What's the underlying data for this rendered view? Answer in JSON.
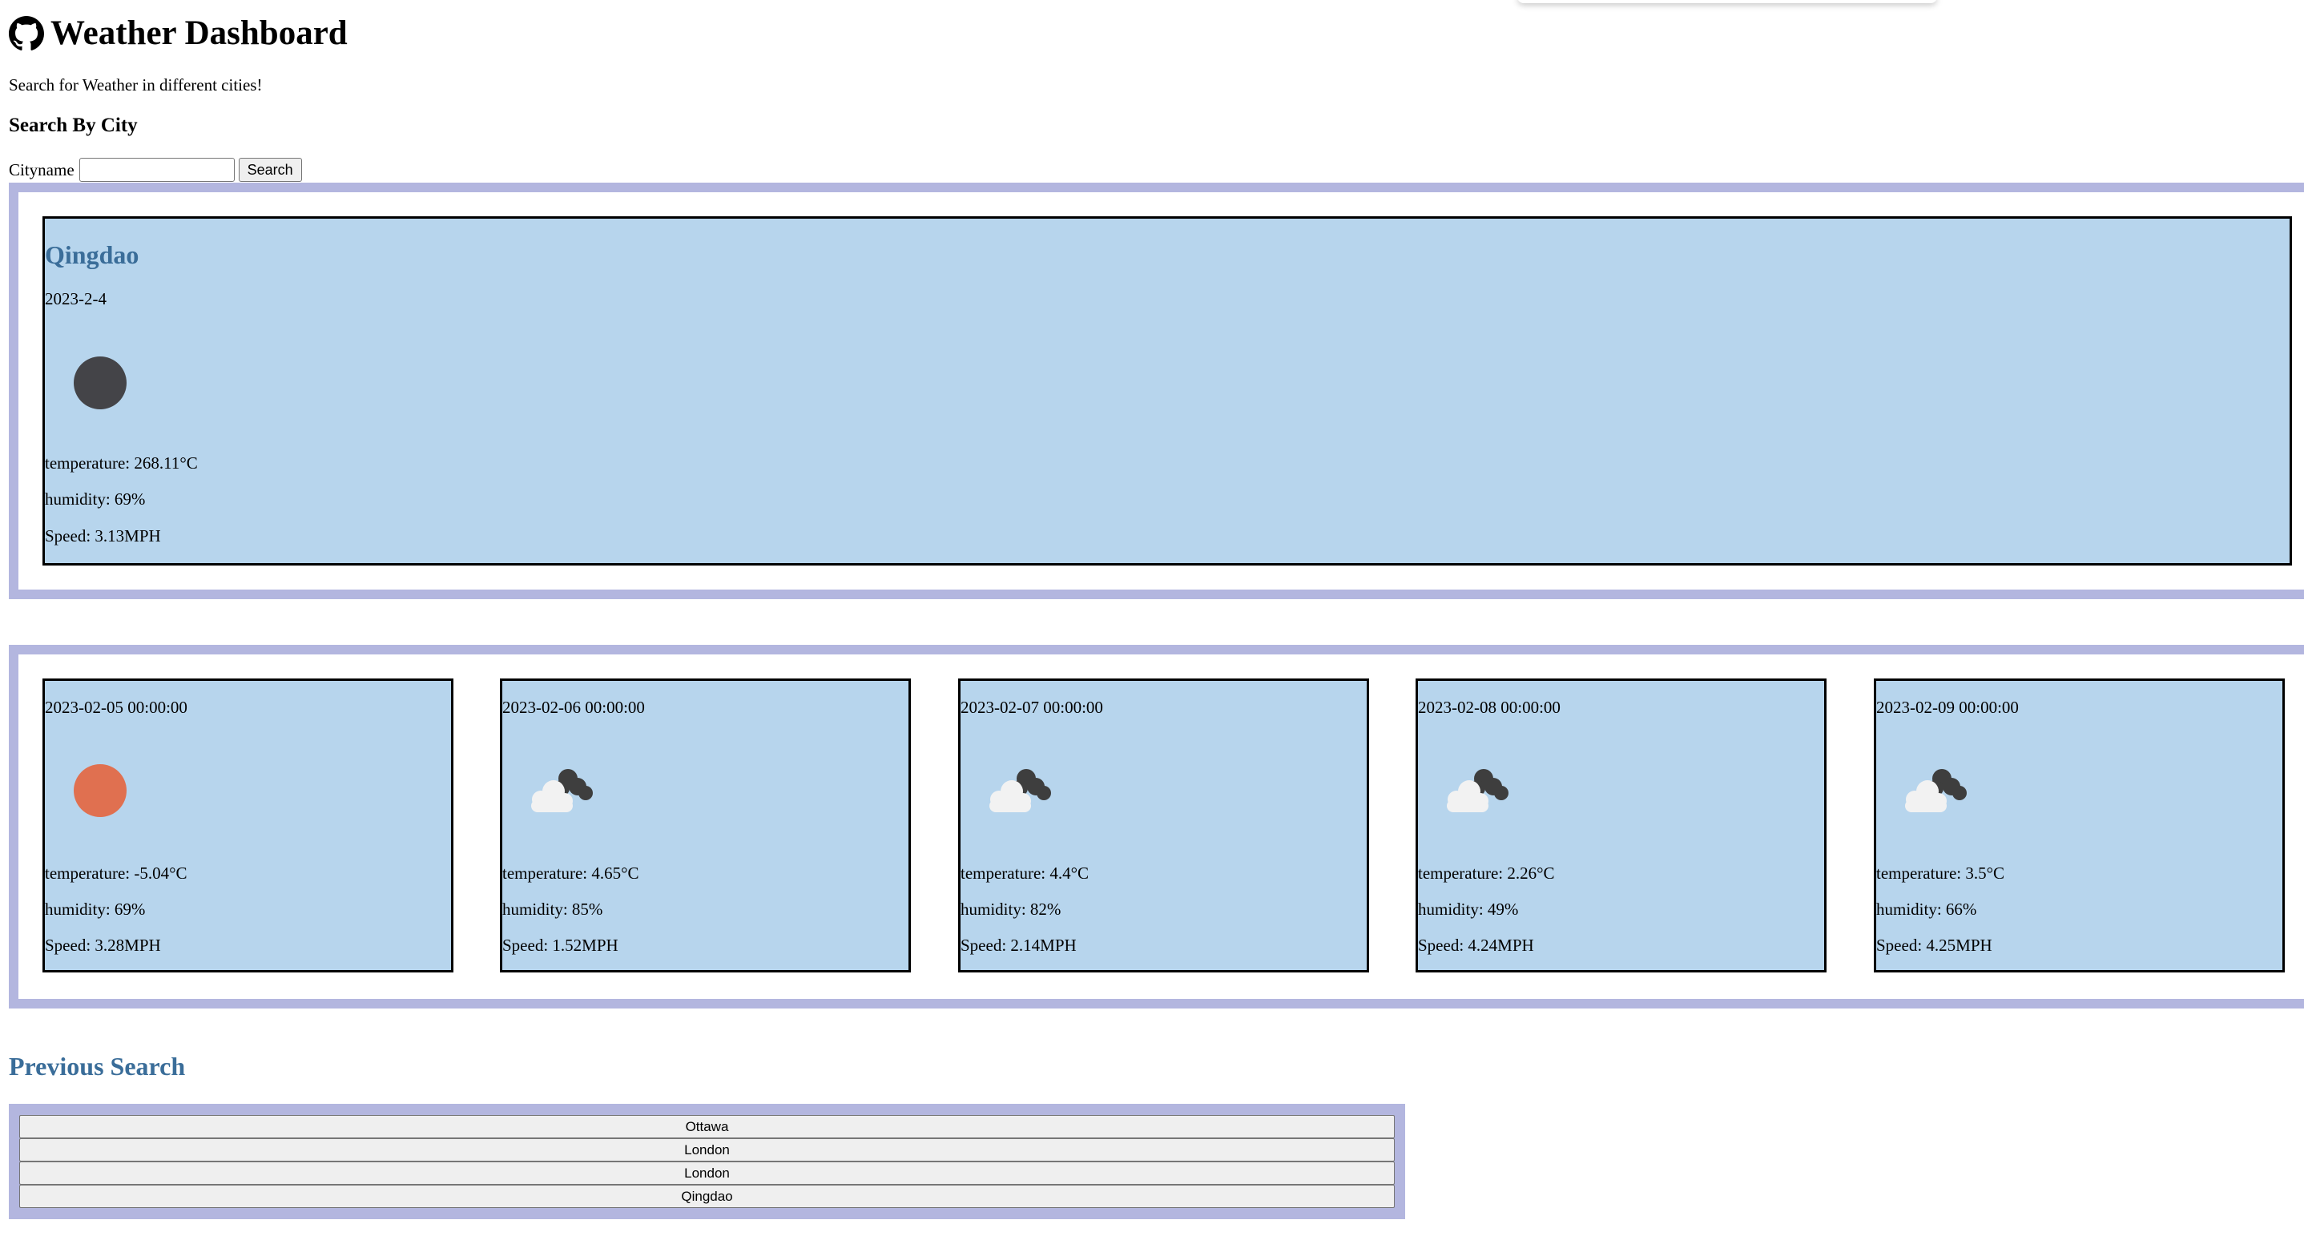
{
  "header": {
    "title": "Weather Dashboard",
    "logo_icon": "github-icon"
  },
  "tagline": "Search for Weather in different cities!",
  "search": {
    "heading": "Search By City",
    "label": "Cityname",
    "value": "",
    "placeholder": "",
    "button_label": "Search"
  },
  "current": {
    "city": "Qingdao",
    "date": "2023-2-4",
    "icon": "moon-icon",
    "temperature": "temperature: 268.11°C",
    "humidity": "humidity: 69%",
    "speed": "Speed: 3.13MPH"
  },
  "forecast": [
    {
      "datetime": "2023-02-05 00:00:00",
      "icon": "sun-icon",
      "temperature": "temperature: -5.04°C",
      "humidity": "humidity: 69%",
      "speed": "Speed: 3.28MPH"
    },
    {
      "datetime": "2023-02-06 00:00:00",
      "icon": "broken-clouds-icon",
      "temperature": "temperature: 4.65°C",
      "humidity": "humidity: 85%",
      "speed": "Speed: 1.52MPH"
    },
    {
      "datetime": "2023-02-07 00:00:00",
      "icon": "broken-clouds-icon",
      "temperature": "temperature: 4.4°C",
      "humidity": "humidity: 82%",
      "speed": "Speed: 2.14MPH"
    },
    {
      "datetime": "2023-02-08 00:00:00",
      "icon": "broken-clouds-icon",
      "temperature": "temperature: 2.26°C",
      "humidity": "humidity: 49%",
      "speed": "Speed: 4.24MPH"
    },
    {
      "datetime": "2023-02-09 00:00:00",
      "icon": "broken-clouds-icon",
      "temperature": "temperature: 3.5°C",
      "humidity": "humidity: 66%",
      "speed": "Speed: 4.25MPH"
    }
  ],
  "history": {
    "heading": "Previous Search",
    "items": [
      "Ottawa",
      "London",
      "London",
      "Qingdao"
    ]
  },
  "colors": {
    "panel_border": "#b3b6df",
    "card_bg": "#b7d5ed",
    "heading_blue": "#3a6d99",
    "sun": "#e07050",
    "moon": "#444448"
  }
}
